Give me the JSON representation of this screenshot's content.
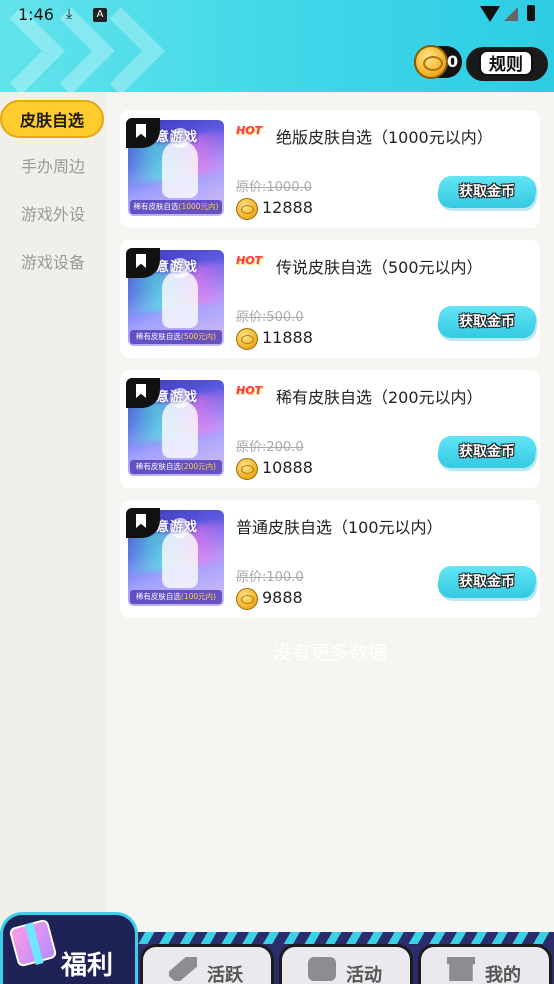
{
  "status_bar": {
    "time": "1:46",
    "a_label": "A"
  },
  "header": {
    "coin_count": "0",
    "rules_label": "规则"
  },
  "sidebar": {
    "items": [
      {
        "label": "皮肤自选",
        "active": true
      },
      {
        "label": "手办周边",
        "active": false
      },
      {
        "label": "游戏外设",
        "active": false
      },
      {
        "label": "游戏设备",
        "active": false
      }
    ]
  },
  "products": [
    {
      "hot": true,
      "hot_label": "HOT",
      "title": "绝版皮肤自选（1000元以内）",
      "original_price": "原价:1000.0",
      "price": "12888",
      "thumb_title": "任意游戏",
      "thumb_caption": "稀有皮肤自选",
      "thumb_caption_value": "(1000元内)",
      "button": "获取金币"
    },
    {
      "hot": true,
      "hot_label": "HOT",
      "title": "传说皮肤自选（500元以内）",
      "original_price": "原价:500.0",
      "price": "11888",
      "thumb_title": "任意游戏",
      "thumb_caption": "稀有皮肤自选",
      "thumb_caption_value": "(500元内)",
      "button": "获取金币"
    },
    {
      "hot": true,
      "hot_label": "HOT",
      "title": "稀有皮肤自选（200元以内）",
      "original_price": "原价:200.0",
      "price": "10888",
      "thumb_title": "任意游戏",
      "thumb_caption": "稀有皮肤自选",
      "thumb_caption_value": "(200元内)",
      "button": "获取金币"
    },
    {
      "hot": false,
      "hot_label": "",
      "title": "普通皮肤自选（100元以内）",
      "original_price": "原价:100.0",
      "price": "9888",
      "thumb_title": "任意游戏",
      "thumb_caption": "稀有皮肤自选",
      "thumb_caption_value": "(100元内)",
      "button": "获取金币"
    }
  ],
  "list_end_text": "没有更多数据",
  "bottom_nav": {
    "fuli": "福利",
    "tabs": [
      {
        "label": "活跃",
        "icon": "rocket-icon"
      },
      {
        "label": "活动",
        "icon": "gamepad-icon"
      },
      {
        "label": "我的",
        "icon": "box-icon"
      }
    ]
  },
  "colors": {
    "header": "#3fd7e8",
    "active_tab": "#ffcc2e",
    "nav": "#2b2d6a",
    "button": "#34c9e2"
  }
}
